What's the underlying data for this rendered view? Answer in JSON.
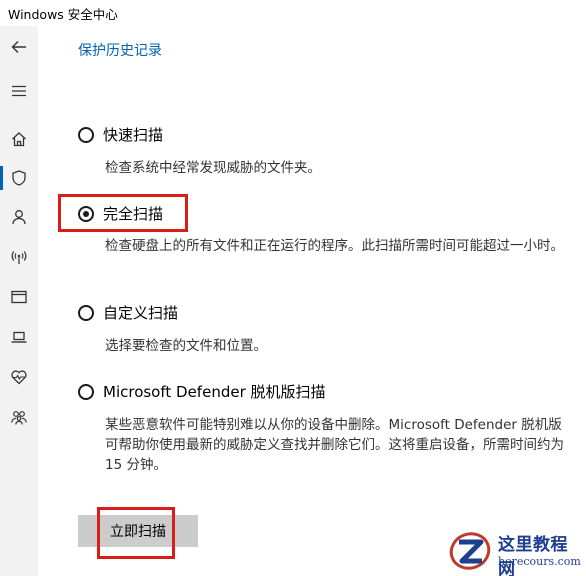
{
  "window": {
    "title": "Windows 安全中心"
  },
  "rail": {
    "icons": [
      "back-arrow-icon",
      "menu-icon",
      "home-icon",
      "shield-icon",
      "person-icon",
      "wireless-icon",
      "app-browser-icon",
      "laptop-icon",
      "heart-pulse-icon",
      "family-icon"
    ],
    "selected": "shield-icon"
  },
  "content": {
    "history_link": "保护历史记录",
    "options": [
      {
        "label": "快速扫描",
        "checked": false,
        "desc": "检查系统中经常发现威胁的文件夹。"
      },
      {
        "label": "完全扫描",
        "checked": true,
        "desc": "检查硬盘上的所有文件和正在运行的程序。此扫描所需时间可能超过一小时。"
      },
      {
        "label": "自定义扫描",
        "checked": false,
        "desc": "选择要检查的文件和位置。"
      },
      {
        "label": "Microsoft Defender 脱机版扫描",
        "checked": false,
        "desc": "某些恶意软件可能特别难以从你的设备中删除。Microsoft Defender 脱机版可帮助你使用最新的威胁定义查找并删除它们。这将重启设备，所需时间约为 15 分钟。"
      }
    ],
    "scan_button": "立即扫描"
  },
  "watermark": {
    "text": "这里教程网",
    "url": "herecours.com"
  },
  "colors": {
    "accent": "#0063b1",
    "highlight": "#d91e18",
    "rail_bg": "#f2f2f2",
    "button_bg": "#cccccc"
  }
}
